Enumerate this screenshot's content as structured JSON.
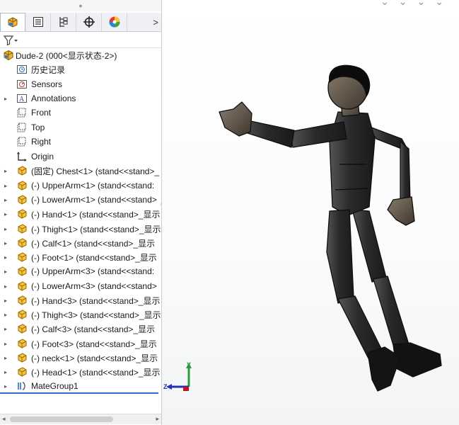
{
  "panel": {
    "tabs": [
      {
        "name": "featuremanager-tab",
        "icon": "featuremanager-icon",
        "active": true
      },
      {
        "name": "propertymanager-tab",
        "icon": "propertymanager-icon",
        "active": false
      },
      {
        "name": "configurationmanager-tab",
        "icon": "configurationmanager-icon",
        "active": false
      },
      {
        "name": "dimxpert-tab",
        "icon": "dimxpert-crosshair-icon",
        "active": false
      },
      {
        "name": "display-manager-tab",
        "icon": "display-manager-icon",
        "active": false
      }
    ],
    "more_label": ">",
    "filter_icon": "filter-icon"
  },
  "tree": {
    "root": {
      "label": "Dude-2  (000<显示状态-2>)",
      "icon": "assembly-icon"
    },
    "items": [
      {
        "label": "历史记录",
        "icon": "history-icon",
        "expandable": false
      },
      {
        "label": "Sensors",
        "icon": "sensors-icon",
        "expandable": false
      },
      {
        "label": "Annotations",
        "icon": "annotations-icon",
        "expandable": true
      },
      {
        "label": "Front",
        "icon": "plane-icon",
        "expandable": false
      },
      {
        "label": "Top",
        "icon": "plane-icon",
        "expandable": false
      },
      {
        "label": "Right",
        "icon": "plane-icon",
        "expandable": false
      },
      {
        "label": "Origin",
        "icon": "origin-icon",
        "expandable": false
      },
      {
        "label": "(固定) Chest<1> (stand<<stand>_",
        "icon": "part-icon",
        "expandable": true
      },
      {
        "label": "(-) UpperArm<1> (stand<<stand:",
        "icon": "part-icon",
        "expandable": true
      },
      {
        "label": "(-) LowerArm<1> (stand<<stand>",
        "icon": "part-icon",
        "expandable": true
      },
      {
        "label": "(-) Hand<1> (stand<<stand>_显示",
        "icon": "part-icon",
        "expandable": true
      },
      {
        "label": "(-) Thigh<1> (stand<<stand>_显示",
        "icon": "part-icon",
        "expandable": true
      },
      {
        "label": "(-) Calf<1> (stand<<stand>_显示",
        "icon": "part-icon",
        "expandable": true
      },
      {
        "label": "(-) Foot<1> (stand<<stand>_显示",
        "icon": "part-icon",
        "expandable": true
      },
      {
        "label": "(-) UpperArm<3> (stand<<stand:",
        "icon": "part-icon",
        "expandable": true
      },
      {
        "label": "(-) LowerArm<3> (stand<<stand>",
        "icon": "part-icon",
        "expandable": true
      },
      {
        "label": "(-) Hand<3> (stand<<stand>_显示",
        "icon": "part-icon",
        "expandable": true
      },
      {
        "label": "(-) Thigh<3> (stand<<stand>_显示",
        "icon": "part-icon",
        "expandable": true
      },
      {
        "label": "(-) Calf<3> (stand<<stand>_显示",
        "icon": "part-icon",
        "expandable": true
      },
      {
        "label": "(-) Foot<3> (stand<<stand>_显示",
        "icon": "part-icon",
        "expandable": true
      },
      {
        "label": "(-) neck<1> (stand<<stand>_显示",
        "icon": "part-icon",
        "expandable": true
      },
      {
        "label": "(-) Head<1> (stand<<stand>_显示",
        "icon": "part-icon",
        "expandable": true
      },
      {
        "label": "MateGroup1",
        "icon": "mategroup-icon",
        "expandable": true
      }
    ]
  },
  "viewport": {
    "triad": {
      "y_label": "Y",
      "z_label": "Z",
      "x_color": "#c0161b",
      "y_color": "#2c9a3a",
      "z_color": "#2230b8"
    },
    "model_color": "#2b2b2b",
    "accent": "#2f6fc6"
  }
}
